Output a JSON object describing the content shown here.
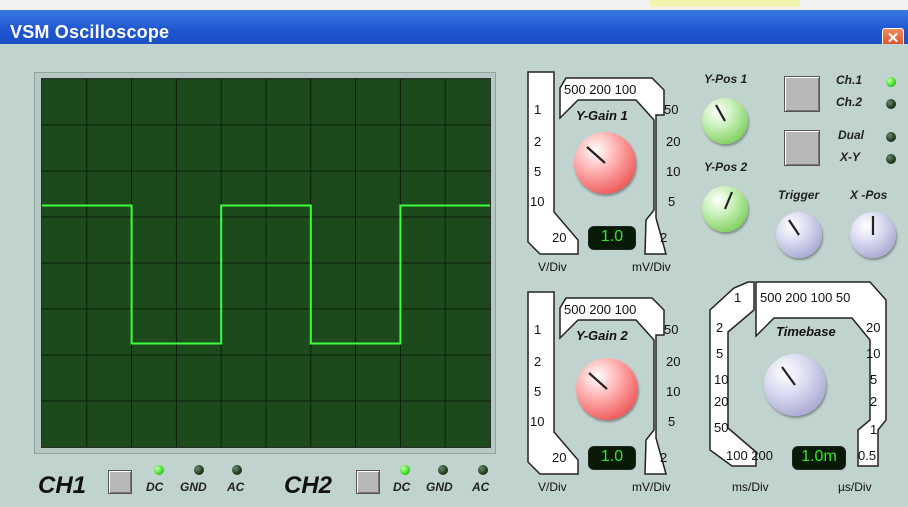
{
  "window": {
    "title": "VSM Oscilloscope",
    "close_icon": "close-icon"
  },
  "channel_bar": {
    "ch1": {
      "label": "CH1",
      "dc": "DC",
      "gnd": "GND",
      "ac": "AC",
      "selected": "DC"
    },
    "ch2": {
      "label": "CH2",
      "dc": "DC",
      "gnd": "GND",
      "ac": "AC",
      "selected": "DC"
    }
  },
  "ygain1": {
    "title": "Y-Gain 1",
    "top_scale": "500 200 100",
    "left_scale": [
      "1",
      "2",
      "5",
      "10"
    ],
    "right_scale": [
      "50",
      "20",
      "10",
      "5"
    ],
    "bottom_left": "20",
    "bottom_right": "2",
    "readout": "1.0",
    "unit_left": "V/Div",
    "unit_right": "mV/Div"
  },
  "ygain2": {
    "title": "Y-Gain 2",
    "top_scale": "500 200 100",
    "left_scale": [
      "1",
      "2",
      "5",
      "10"
    ],
    "right_scale": [
      "50",
      "20",
      "10",
      "5"
    ],
    "bottom_left": "20",
    "bottom_right": "2",
    "readout": "1.0",
    "unit_left": "V/Div",
    "unit_right": "mV/Div"
  },
  "ypos": {
    "ypos1": "Y-Pos 1",
    "ypos2": "Y-Pos 2"
  },
  "mode": {
    "ch1": "Ch.1",
    "ch2": "Ch.2",
    "dual": "Dual",
    "xy": "X-Y",
    "active": "Ch.1"
  },
  "trigger": {
    "trigger": "Trigger",
    "xpos": "X -Pos"
  },
  "timebase": {
    "title": "Timebase",
    "top_left": "1",
    "top_scale": "500 200 100 50",
    "left_scale": [
      "2",
      "5",
      "10",
      "20",
      "50"
    ],
    "right_scale": [
      "20",
      "10",
      "5",
      "2",
      "1"
    ],
    "bottom_left": "100 200",
    "bottom_right": "0.5",
    "readout": "1.0m",
    "unit_left": "ms/Div",
    "unit_right": "µs/Div"
  },
  "colors": {
    "screen": "#1c4a1c",
    "trace": "#3cff3c",
    "grid": "#0d1f0d",
    "accent_title": "#2257d3"
  },
  "trace": {
    "shape": "square-wave",
    "high_level_div": 1.0,
    "low_level_div": -3.5
  }
}
